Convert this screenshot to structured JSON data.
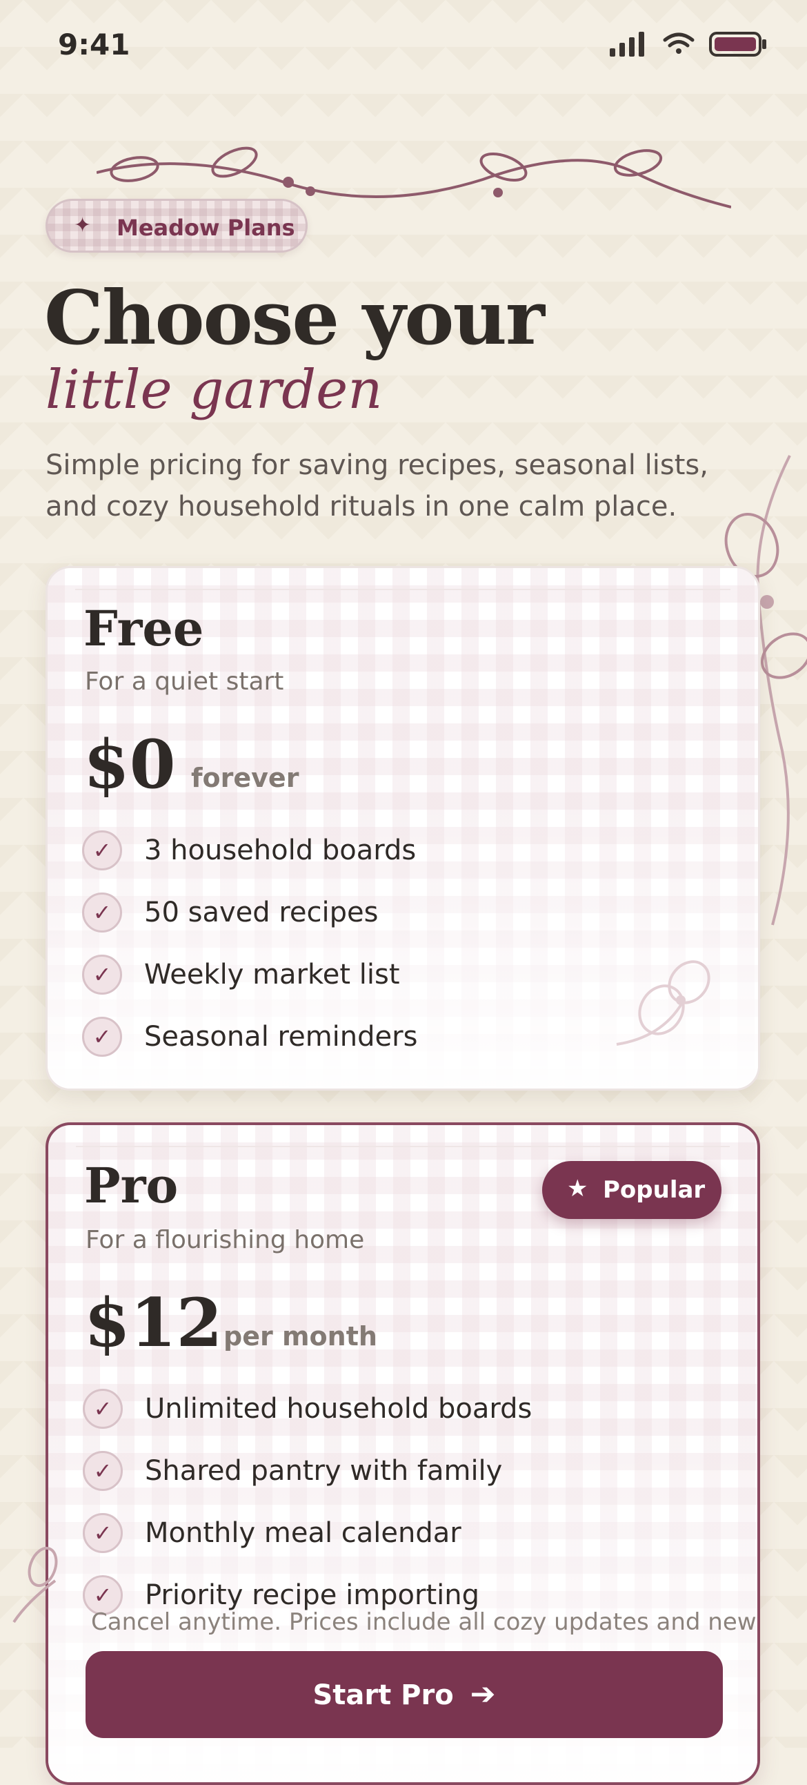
{
  "status_bar": {
    "time": "9:41"
  },
  "header": {
    "badge_label": "Meadow Plans",
    "title": "Choose your",
    "subtitle": "little garden",
    "intro": "Simple pricing for saving recipes, seasonal lists, and cozy household rituals in one calm place."
  },
  "plans": {
    "free": {
      "name": "Free",
      "tagline": "For a quiet start",
      "price": "$0",
      "period": "forever",
      "features": [
        "3 household boards",
        "50 saved recipes",
        "Weekly market list",
        "Seasonal reminders"
      ]
    },
    "pro": {
      "name": "Pro",
      "tagline": "For a flourishing home",
      "badge": "Popular",
      "price": "$12",
      "period": "per month",
      "features": [
        "Unlimited household boards",
        "Shared pantry with family",
        "Monthly meal calendar",
        "Priority recipe importing"
      ],
      "note": "Cancel anytime. Prices include all cozy updates and new",
      "cta_label": "Start Pro"
    }
  },
  "icons": {
    "badge": "sparkle-icon",
    "check": "check-icon",
    "popular": "star-icon",
    "cta": "arrow-right-icon"
  },
  "colors": {
    "accent": "#7a3550",
    "background": "#f4efe4",
    "text": "#2f2a27"
  }
}
